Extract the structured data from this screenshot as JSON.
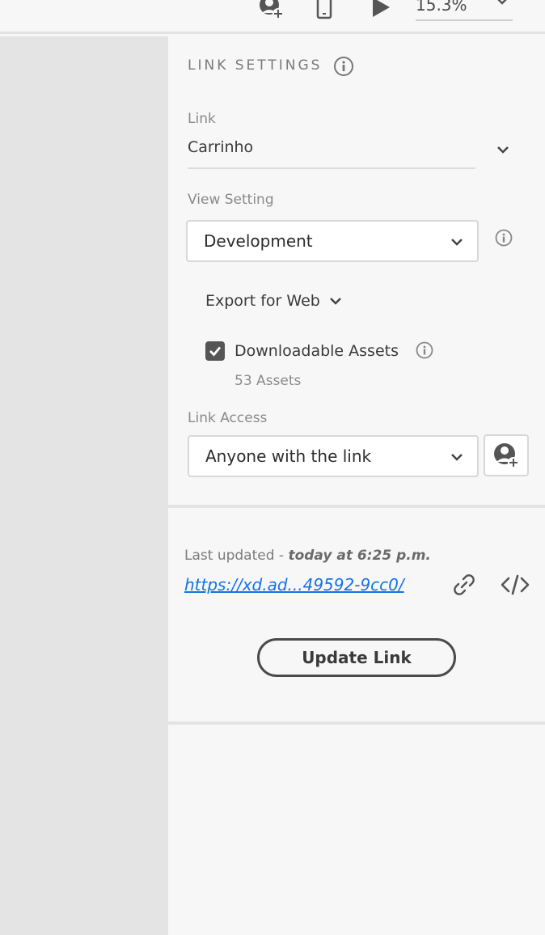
{
  "topbar": {
    "icons": [
      "invite-user-icon",
      "device-preview-icon",
      "play-icon"
    ],
    "zoom": {
      "value": "15.3%"
    }
  },
  "panel": {
    "title": "LINK SETTINGS",
    "link": {
      "label": "Link",
      "value": "Carrinho"
    },
    "view_setting": {
      "label": "View Setting",
      "value": "Development"
    },
    "export": {
      "label": "Export for Web"
    },
    "downloadable": {
      "label": "Downloadable Assets",
      "checked": true,
      "count": "53 Assets"
    },
    "link_access": {
      "label": "Link Access",
      "value": "Anyone with the link"
    },
    "status": {
      "prefix": "Last updated - ",
      "time": "today at 6:25 p.m.",
      "url": "https://xd.ad...49592-9cc0/"
    },
    "update_button": "Update Link"
  },
  "colors": {
    "accent_link": "#1473e6",
    "canvas": "#e4e4e4",
    "panel": "#f7f7f7"
  }
}
